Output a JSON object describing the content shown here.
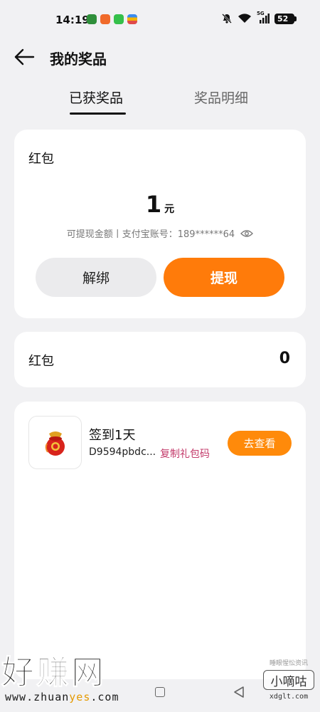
{
  "status_bar": {
    "time": "14:19",
    "network": "5G",
    "battery": "52",
    "icons": [
      "app-green-icon",
      "app-orange-icon",
      "phone-app-icon",
      "wallet-app-icon",
      "bell-off-icon",
      "wifi-icon",
      "signal-icon",
      "battery-icon"
    ]
  },
  "header": {
    "title": "我的奖品"
  },
  "tabs": [
    {
      "label": "已获奖品",
      "active": true
    },
    {
      "label": "奖品明细",
      "active": false
    }
  ],
  "redpacket_card": {
    "title": "红包",
    "amount": "1",
    "unit": "元",
    "account_text": "可提现金额丨支付宝账号：189******64",
    "unbind_label": "解绑",
    "withdraw_label": "提现"
  },
  "redpacket_count_card": {
    "label": "红包",
    "count": "0"
  },
  "prize_item": {
    "name": "签到1天",
    "code": "D9594pbdc...",
    "copy_label": "复制礼包码",
    "view_label": "去查看"
  },
  "watermarks": {
    "left_big": "好赚网",
    "left_url_pre": "www.zhuan",
    "left_url_hl": "yes",
    "left_url_post": ".com",
    "right_small": "睡眼惺忪资讯",
    "right_box": "小嘀咕",
    "right_url": "xdglt.com"
  },
  "colors": {
    "accent_orange": "#ff7b0a",
    "copy_link": "#c33a6a",
    "background": "#f1f1f3"
  }
}
